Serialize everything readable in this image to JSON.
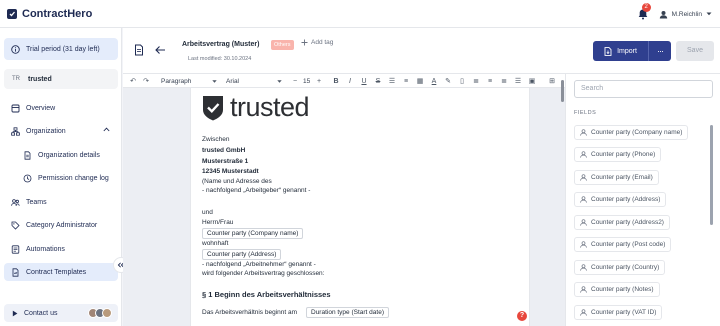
{
  "app": {
    "name": "ContractHero"
  },
  "topbar": {
    "notifications_count": "2",
    "user_name": "M.Reichlin"
  },
  "sidebar": {
    "trial_text": "Trial period (31 day left)",
    "tenant_abbr": "TR",
    "tenant_name": "trusted",
    "items": {
      "overview": "Overview",
      "organization": "Organization",
      "organization_details": "Organization details",
      "permission_change_log": "Permission change log",
      "teams": "Teams",
      "category_administrator": "Category Administrator",
      "automations": "Automations",
      "contract_templates": "Contract Templates"
    },
    "contact_label": "Contact us"
  },
  "doc_header": {
    "title": "Arbeitsvertrag (Muster)",
    "last_modified": "Last modified: 30.10.2024",
    "tag": "Others",
    "add_tag": "Add tag",
    "import_label": "Import",
    "more_label": "···",
    "save_label": "Save"
  },
  "toolbar": {
    "block_type": "Paragraph",
    "font": "Arial",
    "font_size": "15"
  },
  "document": {
    "logo_word": "trusted",
    "lines": {
      "zwischen": "Zwischen",
      "company": "trusted GmbH",
      "street": "Musterstraße 1",
      "city": "12345 Musterstadt",
      "name_addr": "(Name und Adresse des",
      "employer": "- nachfolgend „Arbeitgeber“ genannt -",
      "und": "und",
      "herrn": "Herrn/Frau",
      "wohnhaft": "wohnhaft",
      "employee": "- nachfolgend „Arbeitnehmer“ genannt -",
      "concluded": "wird folgender Arbeitsvertrag geschlossen:",
      "section1": "§ 1 Beginn des Arbeitsverhältnisses",
      "begins": "Das Arbeitsverhältnis beginnt am"
    },
    "chips": {
      "company_name": "Counter party (Company name)",
      "address": "Counter party (Address)",
      "start_date": "Duration type (Start date)"
    }
  },
  "fields_panel": {
    "search_placeholder": "Search",
    "label": "FIELDS",
    "items": [
      "Counter party (Company name)",
      "Counter party (Phone)",
      "Counter party (Email)",
      "Counter party (Address)",
      "Counter party (Address2)",
      "Counter party (Post code)",
      "Counter party (Country)",
      "Counter party (Notes)",
      "Counter party (VAT ID)"
    ]
  },
  "colors": {
    "brand": "#1e2a52",
    "primary_button": "#2f3f8f",
    "active_bg": "#e4ecfb",
    "alert": "#e8473c",
    "tag_bg": "#f9b4ac"
  }
}
